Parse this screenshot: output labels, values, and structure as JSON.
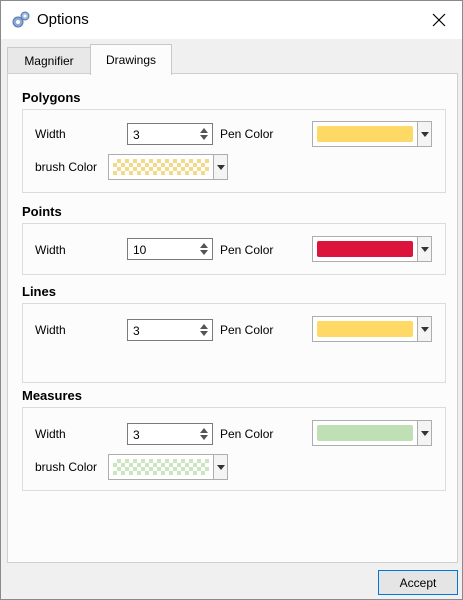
{
  "window": {
    "title": "Options",
    "icon": "gears-icon",
    "close_icon": "close-icon"
  },
  "tabs": [
    {
      "label": "Magnifier",
      "active": false
    },
    {
      "label": "Drawings",
      "active": true
    }
  ],
  "sections": {
    "polygons": {
      "title": "Polygons",
      "width_label": "Width",
      "width_value": "3",
      "pen_label": "Pen Color",
      "pen_color": "#ffd966",
      "brush_label": "brush Color",
      "brush_color": "#f5d98a"
    },
    "points": {
      "title": "Points",
      "width_label": "Width",
      "width_value": "10",
      "pen_label": "Pen Color",
      "pen_color": "#dc143c"
    },
    "lines": {
      "title": "Lines",
      "width_label": "Width",
      "width_value": "3",
      "pen_label": "Pen Color",
      "pen_color": "#ffd966"
    },
    "measures": {
      "title": "Measures",
      "width_label": "Width",
      "width_value": "3",
      "pen_label": "Pen Color",
      "pen_color": "#bfe0b4",
      "brush_label": "brush Color",
      "brush_color": "#c9e6bf"
    }
  },
  "footer": {
    "accept_label": "Accept"
  }
}
